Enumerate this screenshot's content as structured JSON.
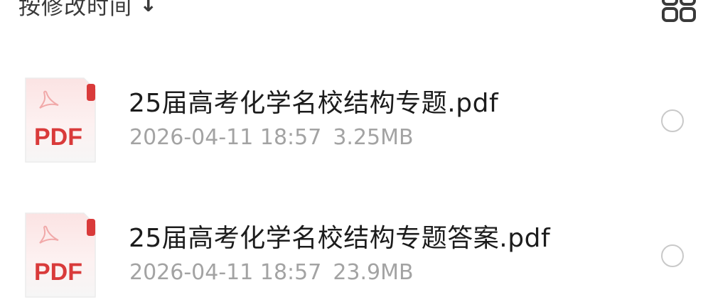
{
  "sort": {
    "label": "按修改时间",
    "arrow_icon": "arrow-down-icon"
  },
  "view_toggle": {
    "icon": "grid-view-icon"
  },
  "files": [
    {
      "name": "25届高考化学名校结构专题.pdf",
      "date": "2026-04-11 18:57",
      "size": "3.25MB",
      "type_label": "PDF",
      "icon": "pdf-file-icon"
    },
    {
      "name": "25届高考化学名校结构专题答案.pdf",
      "date": "2026-04-11 18:57",
      "size": "23.9MB",
      "type_label": "PDF",
      "icon": "pdf-file-icon"
    }
  ],
  "colors": {
    "pdf_red": "#d93a3a",
    "meta_gray": "#a3a3a3",
    "radio_border": "#c9c9c9"
  }
}
